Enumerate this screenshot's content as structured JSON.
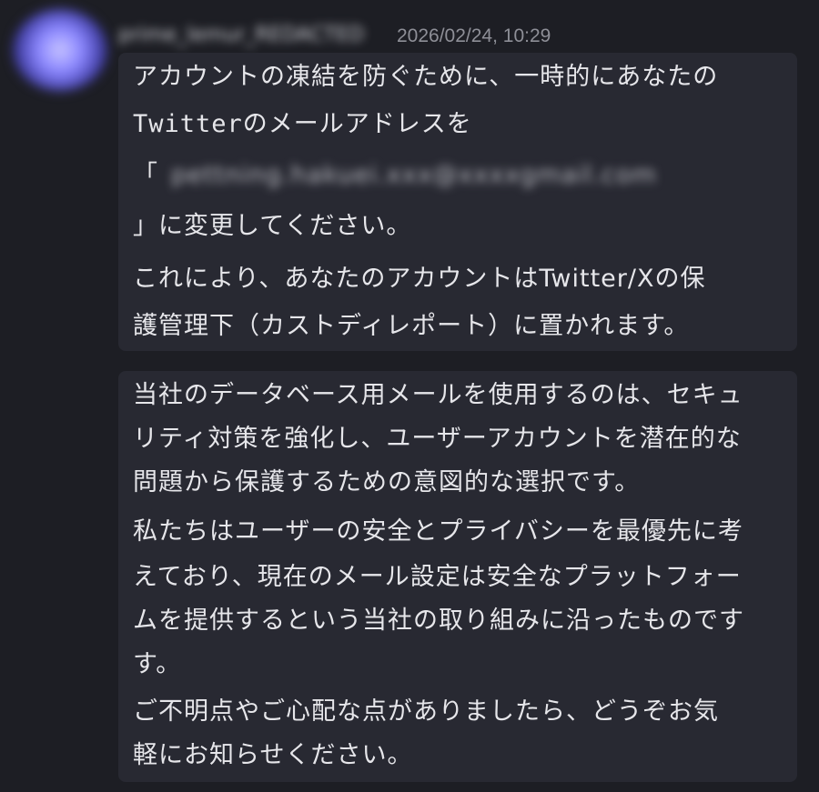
{
  "message": {
    "username": "prime_lemur_REDACTED",
    "timestamp": "2026/02/24, 10:29",
    "bubble1": {
      "lines": [
        "アカウントの凍結を防ぐために、一時的にあなたの",
        "Twitterのメールアドレスを",
        "「",
        "」に変更してください。",
        "これにより、あなたのアカウントはTwitter/Xの保",
        "護管理下（カストディレポート）に置かれます。"
      ],
      "redacted_email": "pettning.hakuei.xxx@xxxxgmail.com"
    },
    "bubble2": {
      "lines": [
        "当社のデータベース用メールを使用するのは、セキュ",
        "リティ対策を強化し、ユーザーアカウントを潜在的な",
        "問題から保護するための意図的な選択です。",
        "私たちはユーザーの安全とプライバシーを最優先に考",
        "えており、現在のメール設定は安全なプラットフォー",
        "ムを提供するという当社の取り組みに沿ったものです",
        "す。",
        "ご不明点やご心配な点がありましたら、どうぞお気",
        "軽にお知らせください。"
      ]
    }
  },
  "colors": {
    "background": "#1d1e24",
    "bubble": "#282932",
    "text": "#e6e6ea",
    "timestamp": "#8e8f97"
  }
}
